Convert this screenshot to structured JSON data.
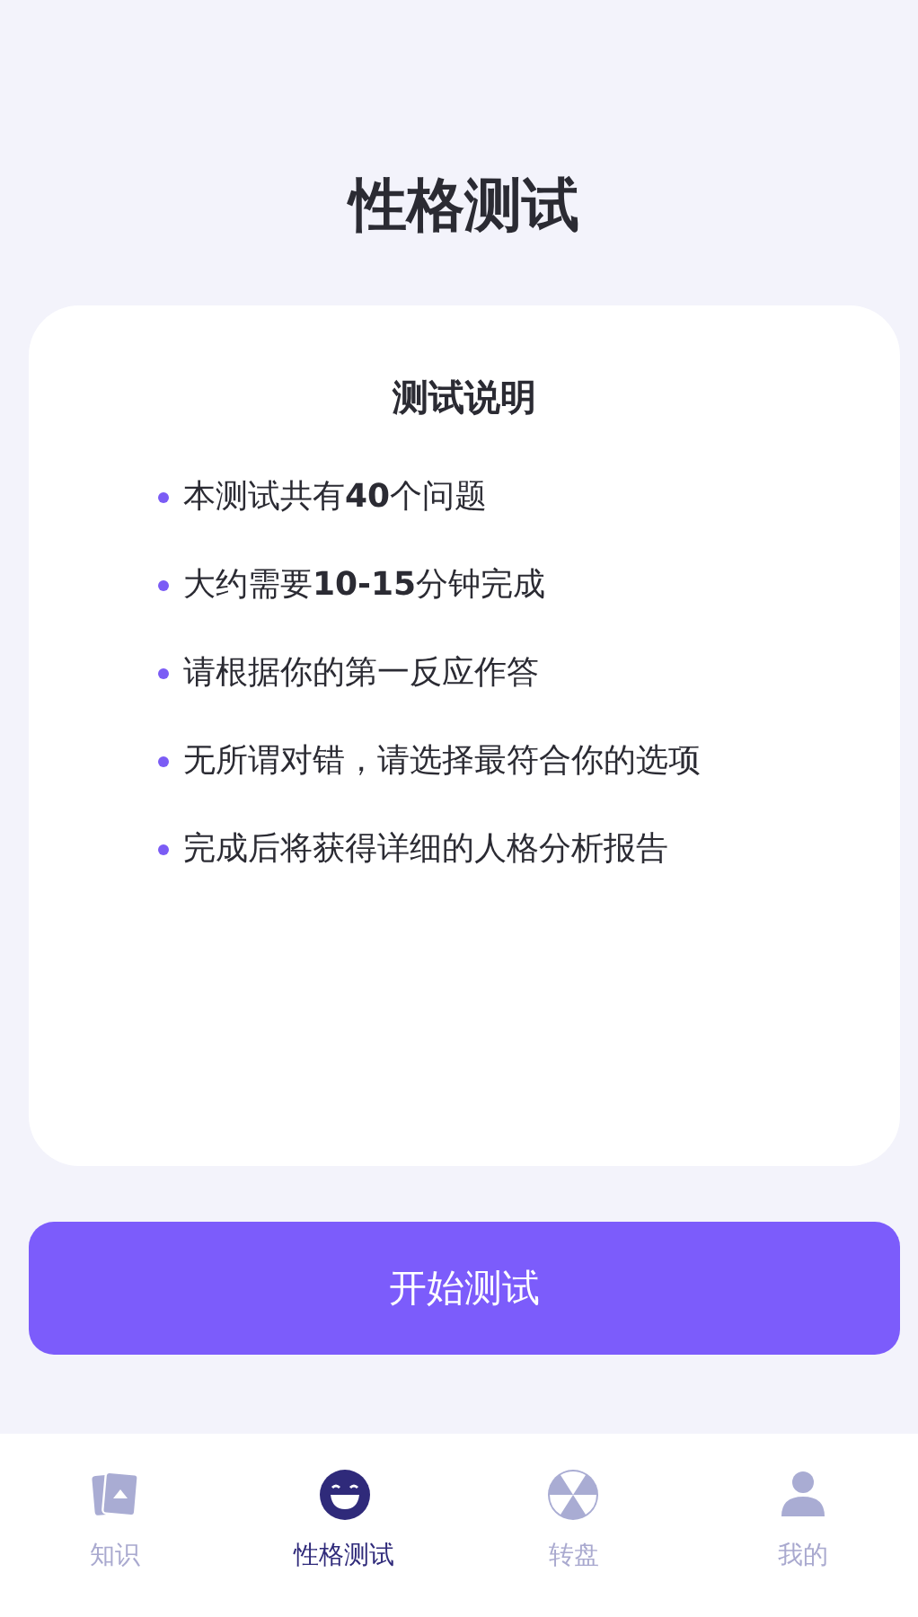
{
  "title": "性格测试",
  "card": {
    "heading": "测试说明",
    "items": [
      "本测试共有**40**个问题",
      "大约需要**10-15**分钟完成",
      "请根据你的第一反应作答",
      "无所谓对错，请选择最符合你的选项",
      "完成后将获得详细的人格分析报告"
    ]
  },
  "start_button": "开始测试",
  "tabs": [
    {
      "kind": "cards",
      "label": "知识",
      "selected": false
    },
    {
      "kind": "smile",
      "label": "性格测试",
      "selected": true
    },
    {
      "kind": "wheel",
      "label": "转盘",
      "selected": false
    },
    {
      "kind": "person",
      "label": "我的",
      "selected": false
    }
  ]
}
